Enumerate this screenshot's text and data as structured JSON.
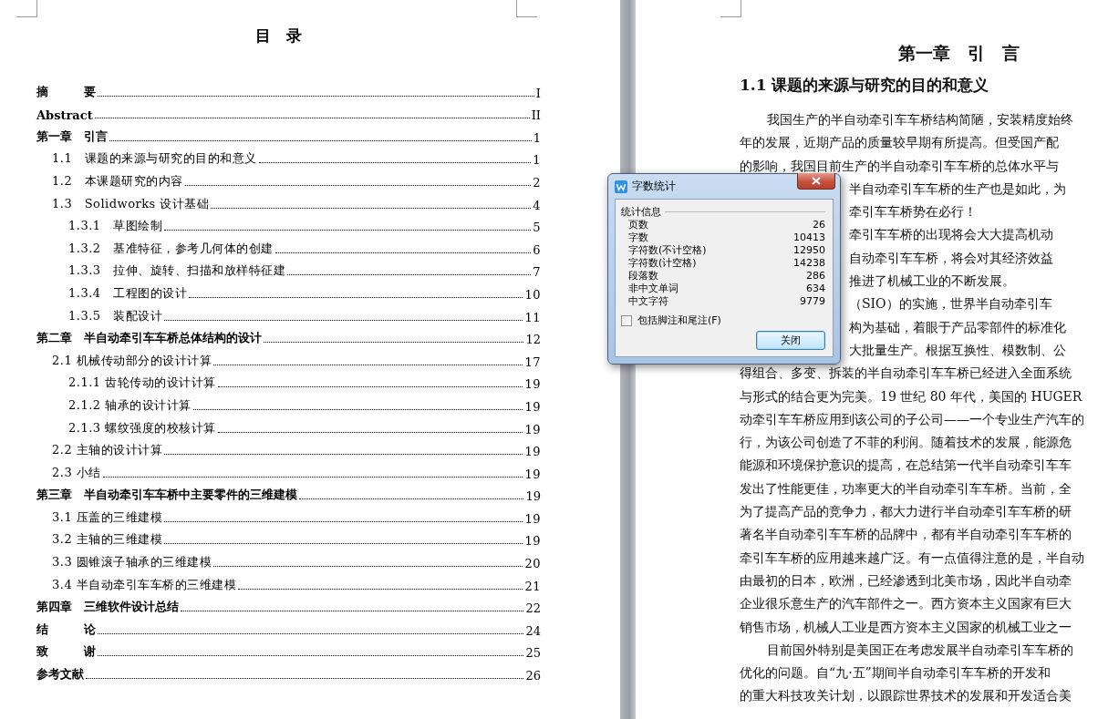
{
  "toc_page": {
    "title": "目　录",
    "entries": [
      {
        "text": "摘　　　要",
        "page": "I"
      },
      {
        "text": "Abstract",
        "page": "II"
      },
      {
        "text": "第一章　引言",
        "page": "1",
        "children": [
          {
            "text": "1.1　课题的来源与研究的目的和意义",
            "page": "1"
          },
          {
            "text": "1.2　本课题研究的内容",
            "page": "2"
          },
          {
            "text": "1.3　Solidworks 设计基础",
            "page": "4",
            "children": [
              {
                "text": "1.3.1　草图绘制",
                "page": "5"
              },
              {
                "text": "1.3.2　基准特征，参考几何体的创建",
                "page": "6"
              },
              {
                "text": "1.3.3　拉伸、旋转、扫描和放样特征建",
                "page": "7"
              },
              {
                "text": "1.3.4　工程图的设计",
                "page": "10"
              },
              {
                "text": "1.3.5　装配设计",
                "page": "11"
              }
            ]
          }
        ]
      },
      {
        "text": "第二章　半自动牵引车车桥总体结构的设计",
        "page": "12",
        "children": [
          {
            "text": "2.1 机械传动部分的设计计算",
            "page": "17",
            "children": [
              {
                "text": "2.1.1 齿轮传动的设计计算",
                "page": "19"
              },
              {
                "text": "2.1.2 轴承的设计计算",
                "page": "19"
              },
              {
                "text": "2.1.3 螺纹强度的校核计算",
                "page": "19"
              }
            ]
          },
          {
            "text": "2.2 主轴的设计计算",
            "page": "19"
          },
          {
            "text": "2.3 小结",
            "page": "19"
          }
        ]
      },
      {
        "text": "第三章　半自动牵引车车桥中主要零件的三维建模",
        "page": "19",
        "children": [
          {
            "text": "3.1 压盖的三维建模",
            "page": "19"
          },
          {
            "text": "3.2 主轴的三维建模",
            "page": "19"
          },
          {
            "text": "3.3 圆锥滚子轴承的三维建模",
            "page": "20"
          },
          {
            "text": "3.4 半自动牵引车车桥的三维建模",
            "page": "21"
          }
        ]
      },
      {
        "text": "第四章　三维软件设计总结",
        "page": "22"
      },
      {
        "text": "结　　　论",
        "page": "24"
      },
      {
        "text": "致　　　谢",
        "page": "25"
      },
      {
        "text": "参考文献",
        "page": "26"
      }
    ]
  },
  "chapter_page": {
    "chapter_title": "第一章　引　言",
    "section_title": "1.1 课题的来源与研究的目的和意义",
    "lines": [
      {
        "kind": "paragraph",
        "text": "我国生产的半自动牵引车车桥结构简陋，安装精度始终"
      },
      {
        "kind": "line",
        "text": "年的发展，近期产品的质量较早期有所提高。但受国产配"
      },
      {
        "kind": "line",
        "text": "的影响，我国目前生产的半自动牵引车车桥的总体水平与"
      },
      {
        "kind": "covered",
        "text": "半自动牵引车车桥的生产也是如此，为"
      },
      {
        "kind": "covered",
        "text": "牵引车车桥势在必行！"
      },
      {
        "kind": "covered",
        "text": "牵引车车桥的出现将会大大提高机动"
      },
      {
        "kind": "covered",
        "text": "自动牵引车车桥，将会对其经济效益"
      },
      {
        "kind": "covered",
        "text": "推进了机械工业的不断发展。"
      },
      {
        "kind": "covered",
        "text": "（SIO）的实施，世界半自动牵引车"
      },
      {
        "kind": "covered",
        "text": "构为基础，着眼于产品零部件的标准化"
      },
      {
        "kind": "covered",
        "text": "大批量生产。根据互换性、模数制、公"
      },
      {
        "kind": "line",
        "text": "得组合、多变、拆装的半自动牵引车车桥已经进入全面系统"
      },
      {
        "kind": "line",
        "text": "与形式的结合更为完美。19 世纪 80 年代，美国的 HUGER"
      },
      {
        "kind": "line",
        "text": "动牵引车车桥应用到该公司的子公司——一个专业生产汽车的"
      },
      {
        "kind": "line",
        "text": "行，为该公司创造了不菲的利润。随着技术的发展，能源危"
      },
      {
        "kind": "line",
        "text": "能源和环境保护意识的提高，在总结第一代半自动牵引车车"
      },
      {
        "kind": "line",
        "text": "发出了性能更佳，功率更大的半自动牵引车车桥。当前，全"
      },
      {
        "kind": "line",
        "text": "为了提高产品的竞争力，都大力进行半自动牵引车车桥的研"
      },
      {
        "kind": "line",
        "text": "著名半自动牵引车车桥的品牌中，都有半自动牵引车车桥的"
      },
      {
        "kind": "line",
        "text": "牵引车车桥的应用越来越广泛。有一点值得注意的是，半自动"
      },
      {
        "kind": "line",
        "text": "由最初的日本，欧洲，已经渗透到北美市场，因此半自动牵"
      },
      {
        "kind": "line",
        "text": "企业很乐意生产的汽车部件之一。西方资本主义国家有巨大"
      },
      {
        "kind": "line",
        "text": "销售市场，机械人工业是西方资本主义国家的机械工业之一"
      },
      {
        "kind": "paragraph",
        "text": "目前国外特别是美国正在考虑发展半自动牵引车车桥的"
      },
      {
        "kind": "line",
        "text": "优化的问题。自“九·五”期间半自动牵引车车桥的开发和"
      },
      {
        "kind": "line",
        "text": "的重大科技攻关计划，以跟踪世界技术的发展和开发适合美"
      }
    ]
  },
  "word_count_dialog": {
    "title": "字数统计",
    "group_label": "统计信息",
    "stats": [
      {
        "label": "页数",
        "value": "26"
      },
      {
        "label": "字数",
        "value": "10413"
      },
      {
        "label": "字符数(不计空格)",
        "value": "12950"
      },
      {
        "label": "字符数(计空格)",
        "value": "14238"
      },
      {
        "label": "段落数",
        "value": "286"
      },
      {
        "label": "非中文单词",
        "value": "634"
      },
      {
        "label": "中文字符",
        "value": "9779"
      }
    ],
    "include_notes": {
      "label": "包括脚注和尾注(F)",
      "checked": false
    },
    "close_button": "关闭"
  }
}
